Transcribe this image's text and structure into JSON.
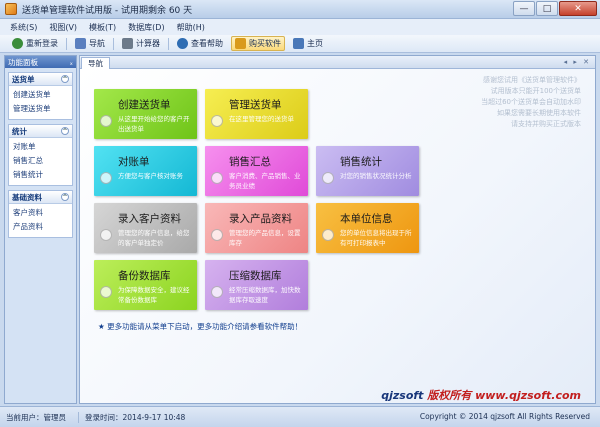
{
  "window": {
    "title": "送货单管理软件试用版 - 试用期剩余 60 天",
    "controls": {
      "minimize": "—",
      "maximize": "□",
      "close": "✕"
    }
  },
  "menu": [
    "系统(S)",
    "视图(V)",
    "模板(T)",
    "数据库(D)",
    "帮助(H)"
  ],
  "toolbar": [
    {
      "label": "重新登录",
      "icon": "relogin-icon",
      "color": "#3b8d3b"
    },
    {
      "label": "导航",
      "icon": "nav-icon",
      "color": "#5a7fbf"
    },
    {
      "label": "计算器",
      "icon": "calculator-icon",
      "color": "#6c7a8a"
    },
    {
      "label": "查看帮助",
      "icon": "help-icon",
      "color": "#2f6db3"
    },
    {
      "label": "购买软件",
      "icon": "buy-icon",
      "color": "#d99a1c"
    },
    {
      "label": "主页",
      "icon": "home-icon",
      "color": "#4a78b8"
    }
  ],
  "sidepanel": {
    "title": "功能面板",
    "pin": "ₓ",
    "groups": [
      {
        "title": "送货单",
        "toggle": "^",
        "items": [
          "创建送货单",
          "管理送货单"
        ]
      },
      {
        "title": "统计",
        "toggle": "^",
        "items": [
          "对账单",
          "销售汇总",
          "销售统计"
        ]
      },
      {
        "title": "基础资料",
        "toggle": "^",
        "items": [
          "客户资料",
          "产品资料"
        ]
      }
    ]
  },
  "main": {
    "tab": "导航",
    "tab_nav": "◂ ▸ ✕",
    "hint_lines": [
      "感谢您试用《送货单管理软件》",
      "试用版本只能开100个送货单",
      "当超过60个送货单会自动加水印",
      "如果您需要长期使用本软件",
      "请支持并购买正式版本"
    ],
    "tiles": [
      {
        "title": "创建送货单",
        "desc": "从这里开始给您的客户开出送货单",
        "color": "#8fdc2c"
      },
      {
        "title": "管理送货单",
        "desc": "在这里管理您的送货单",
        "color": "#ece23a"
      },
      {
        "title": "对账单",
        "desc": "方便您与客户核对账务",
        "color": "#2fd2e8"
      },
      {
        "title": "销售汇总",
        "desc": "客户消费、产品销售、业务员业绩",
        "color": "#f06ee6"
      },
      {
        "title": "销售统计",
        "desc": "对您的销售状况统计分析",
        "color": "#b7a4ea"
      },
      {
        "title": "录入客户资料",
        "desc": "管理您的客户信息，给您的客户单独定价",
        "color": "#c3c3c3"
      },
      {
        "title": "录入产品资料",
        "desc": "管理您的产品信息，设置库存",
        "color": "#f7a1a1"
      },
      {
        "title": "本单位信息",
        "desc": "您的单位信息将出现于所有可打印报表中",
        "color": "#f4a91a"
      },
      {
        "title": "备份数据库",
        "desc": "为保障数据安全，建议经常备份数据库",
        "color": "#a6e53b"
      },
      {
        "title": "压缩数据库",
        "desc": "经常压缩数据库，加快数据库存取速度",
        "color": "#c79ae8"
      }
    ],
    "bottom_note": "★ 更多功能请从菜单下启动，更多功能介绍请参看软件帮助！",
    "brand_name": "qjzsoft",
    "brand_text": " 版权所有 www.qjzsoft.com"
  },
  "status": {
    "user": "当前用户：管理员",
    "login_time": "登录时间：2014-9-17 10:48",
    "copyright": "Copyright © 2014 qjzsoft All Rights Reserved"
  }
}
